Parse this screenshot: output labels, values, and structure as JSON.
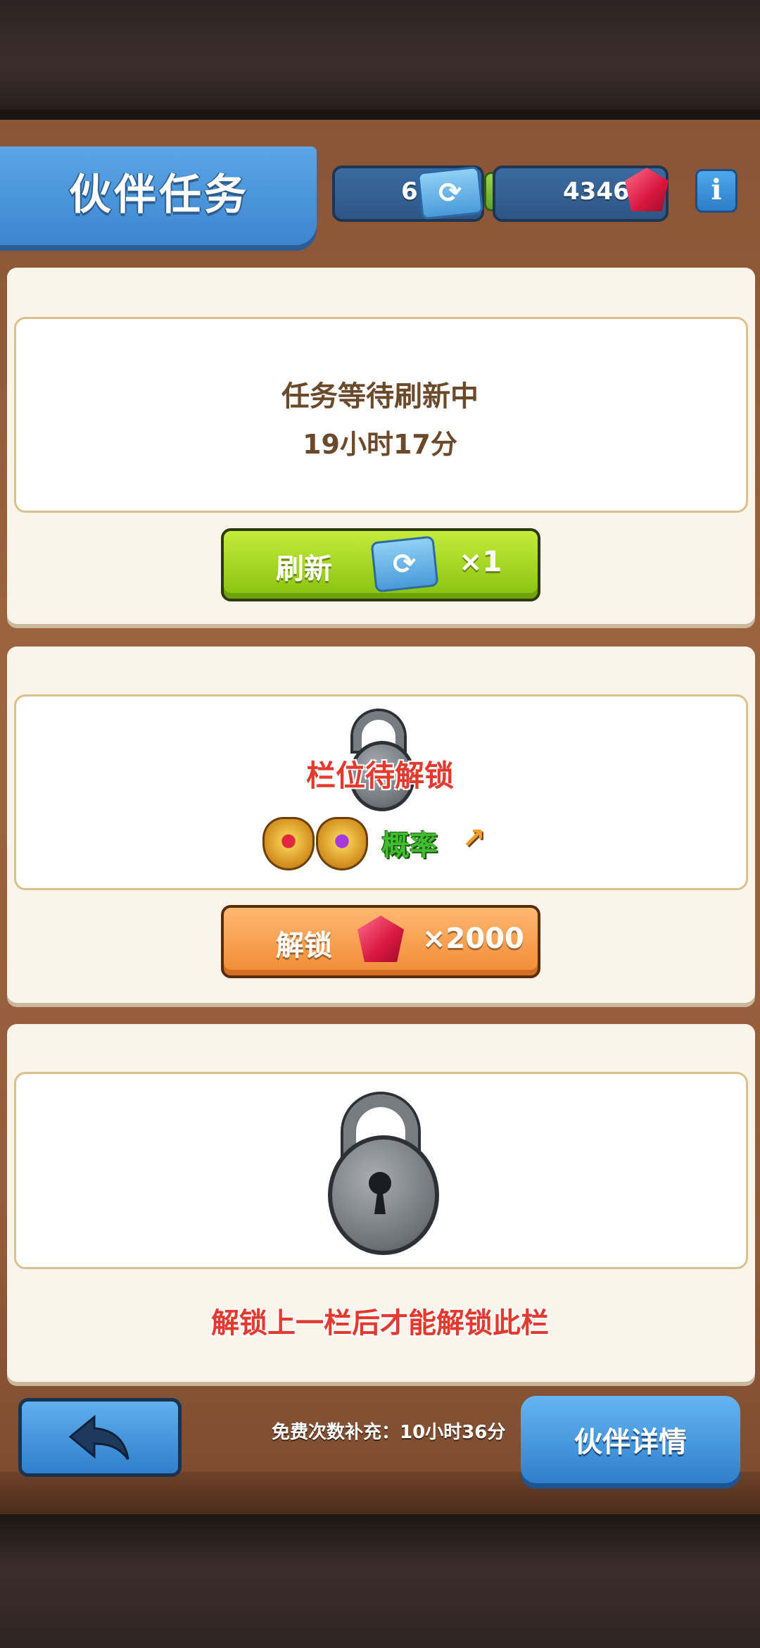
{
  "header": {
    "title": "伙伴任务",
    "tickets": "6",
    "gems": "4346",
    "plus_icon": "plus-icon",
    "info_label": "i"
  },
  "slot1": {
    "status": "任务等待刷新中",
    "countdown": "19小时17分",
    "button_label": "刷新",
    "button_cost": "×1"
  },
  "slot2": {
    "locked_text": "栏位待解锁",
    "prob_label": "概率",
    "button_label": "解锁",
    "button_cost": "×2000"
  },
  "slot3": {
    "hint": "解锁上一栏后才能解锁此栏"
  },
  "footer": {
    "free_refill": "免费次数补充：10小时36分",
    "detail_button": "伙伴详情"
  },
  "colors": {
    "accent_blue": "#3c86cf",
    "refresh_green": "#86c10f",
    "unlock_orange": "#f08a35",
    "warning_red": "#e23a2f"
  }
}
